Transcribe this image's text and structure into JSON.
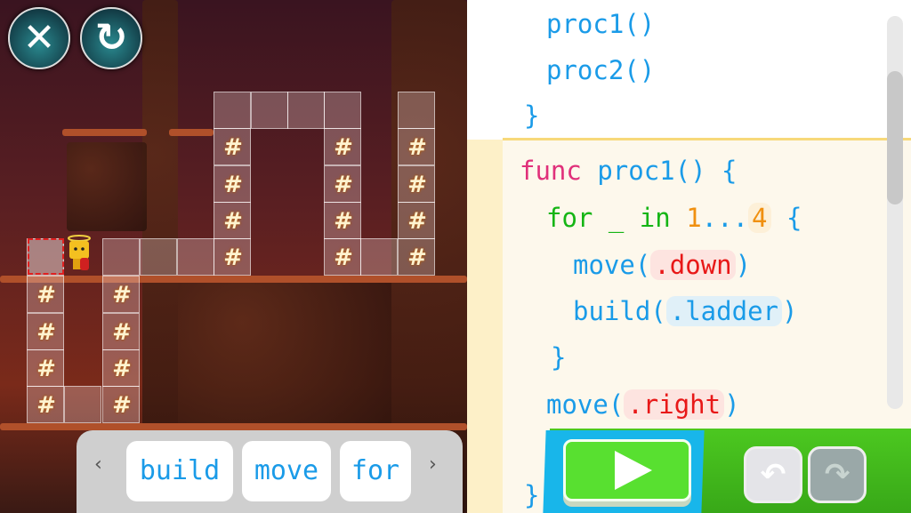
{
  "game": {
    "close_icon": "x-icon",
    "restart_icon": "restart-icon",
    "ladder_glyph": "#",
    "palette": {
      "items": [
        "build",
        "move",
        "for"
      ],
      "prev": "‹",
      "next": "›"
    }
  },
  "code": {
    "lines": {
      "l1": "proc1()",
      "l2": "proc2()",
      "l3": "}",
      "l4_kw": "func",
      "l4_name": "proc1()",
      "l4_brace": "{",
      "l5_for": "for",
      "l5_var": "_",
      "l5_in": "in",
      "l5_from": "1",
      "l5_range": "...",
      "l5_to": "4",
      "l5_brace": "{",
      "l6_fn": "move(",
      "l6_arg": ".down",
      "l6_close": ")",
      "l7_fn": "build(",
      "l7_arg": ".ladder",
      "l7_close": ")",
      "l8": "}",
      "l9_fn": "move(",
      "l9_arg": ".right",
      "l9_close": ")",
      "l10": "m",
      "l11": "}"
    }
  },
  "controls": {
    "play_icon": "play-icon",
    "undo_icon": "undo-icon",
    "redo_icon": "redo-icon",
    "undo": "↶",
    "redo": "↷"
  },
  "colors": {
    "keyword": "#e0307a",
    "function": "#1a9be8",
    "loop": "#15b515",
    "number": "#f09010",
    "argument": "#e81818"
  }
}
